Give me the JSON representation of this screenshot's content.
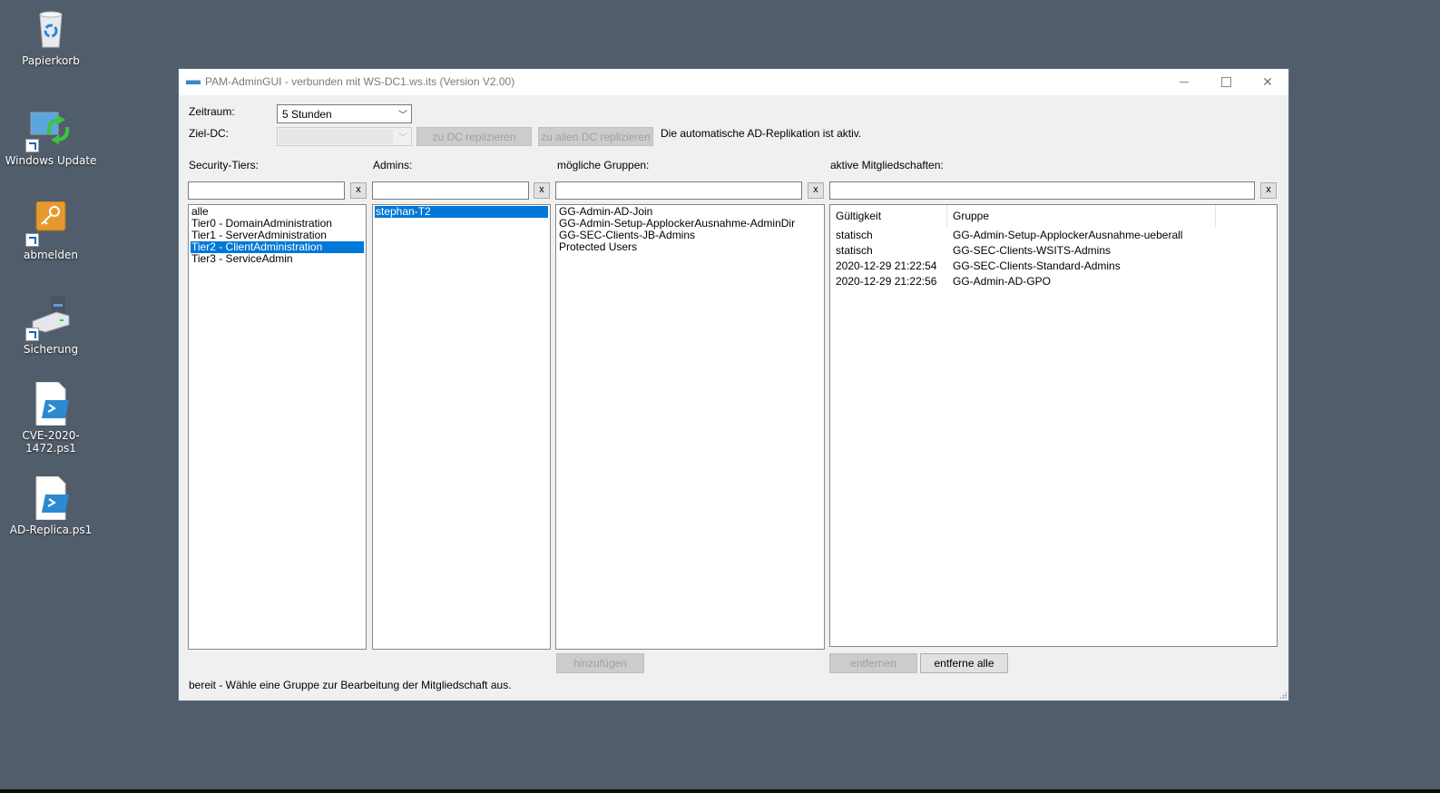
{
  "desktop": {
    "icons": [
      {
        "label": "Papierkorb",
        "icon": "recycle-bin-icon"
      },
      {
        "label": "Windows Update",
        "icon": "windows-update-icon"
      },
      {
        "label": "abmelden",
        "icon": "key-icon"
      },
      {
        "label": "Sicherung",
        "icon": "backup-drive-icon"
      },
      {
        "label": "CVE-2020-1472.ps1",
        "icon": "powershell-script-icon"
      },
      {
        "label": "AD-Replica.ps1",
        "icon": "powershell-script-icon"
      }
    ]
  },
  "window": {
    "title": "PAM-AdminGUI - verbunden mit WS-DC1.ws.its (Version V2.00)"
  },
  "toolbar": {
    "zeitraum_label": "Zeitraum:",
    "zeitraum_value": "5 Stunden",
    "zieldc_label": "Ziel-DC:",
    "zieldc_value": "",
    "replicate_dc_button": "zu DC replizieren",
    "replicate_all_button": "zu allen DC replizieren",
    "replication_status": "Die automatische AD-Replikation ist aktiv."
  },
  "panels": {
    "tiers": {
      "label": "Security-Tiers:",
      "filter": "",
      "clear": "x",
      "items": [
        "alle",
        "Tier0 - DomainAdministration",
        "Tier1 - ServerAdministration",
        "Tier2 - ClientAdministration",
        "Tier3 - ServiceAdmin"
      ],
      "selected_index": 3
    },
    "admins": {
      "label": "Admins:",
      "filter": "",
      "clear": "x",
      "items": [
        "stephan-T2"
      ],
      "selected_index": 0
    },
    "groups": {
      "label": "mögliche Gruppen:",
      "filter": "",
      "clear": "x",
      "items": [
        "GG-Admin-AD-Join",
        "GG-Admin-Setup-ApplockerAusnahme-AdminDir",
        "GG-SEC-Clients-JB-Admins",
        "Protected Users"
      ],
      "add_button": "hinzufügen"
    },
    "memberships": {
      "label": "aktive Mitgliedschaften:",
      "filter": "",
      "clear": "x",
      "columns": [
        "Gültigkeit",
        "Gruppe"
      ],
      "rows": [
        [
          "statisch",
          "GG-Admin-Setup-ApplockerAusnahme-ueberall"
        ],
        [
          "statisch",
          "GG-SEC-Clients-WSITS-Admins"
        ],
        [
          "2020-12-29 21:22:54",
          "GG-SEC-Clients-Standard-Admins"
        ],
        [
          "2020-12-29 21:22:56",
          "GG-Admin-AD-GPO"
        ]
      ],
      "remove_button": "entfernen",
      "remove_all_button": "entferne alle"
    }
  },
  "status_bar": "bereit - Wähle eine Gruppe zur Bearbeitung der Mitgliedschaft aus."
}
